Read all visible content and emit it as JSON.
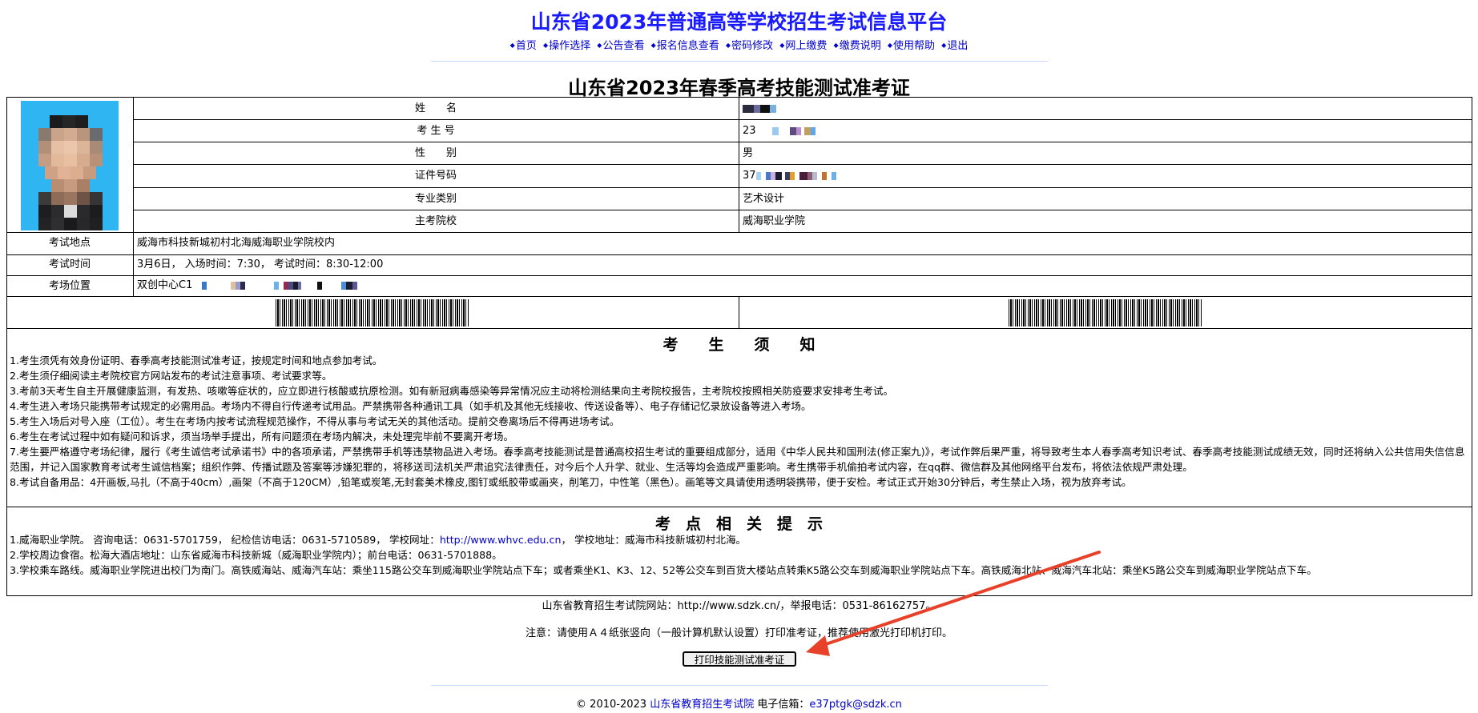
{
  "site": {
    "title": "山东省2023年普通高等学校招生考试信息平台",
    "nav": [
      "首页",
      "操作选择",
      "公告查看",
      "报名信息查看",
      "密码修改",
      "网上缴费",
      "缴费说明",
      "使用帮助",
      "退出"
    ]
  },
  "ticket": {
    "title": "山东省2023年春季高考技能测试准考证",
    "rows": [
      {
        "label": "姓　　名",
        "value": ""
      },
      {
        "label": "考 生 号",
        "value": "23"
      },
      {
        "label": "性　　别",
        "value": "男"
      },
      {
        "label": "证件号码",
        "value": "37"
      },
      {
        "label": "专业类别",
        "value": "艺术设计"
      },
      {
        "label": "主考院校",
        "value": "威海职业学院"
      }
    ],
    "exam_location_label": "考试地点",
    "exam_location": "威海市科技新城初村北海威海职业学院校内",
    "exam_time_label": "考试时间",
    "exam_time": "3月6日， 入场时间：7:30， 考试时间：8:30-12:00",
    "room_label": "考场位置",
    "room": "双创中心C1"
  },
  "notice": {
    "title": "考　　生　　须　　知",
    "items": [
      "1.考生须凭有效身份证明、春季高考技能测试准考证，按规定时间和地点参加考试。",
      "2.考生须仔细阅读主考院校官方网站发布的考试注意事项、考试要求等。",
      "3.考前3天考生自主开展健康监测，有发热、咳嗽等症状的，应立即进行核酸或抗原检测。如有新冠病毒感染等异常情况应主动将检测结果向主考院校报告，主考院校按照相关防疫要求安排考生考试。",
      "4.考生进入考场只能携带考试规定的必需用品。考场内不得自行传递考试用品。严禁携带各种通讯工具（如手机及其他无线接收、传送设备等）、电子存储记忆录放设备等进入考场。",
      "5.考生入场后对号入座（工位）。考生在考场内按考试流程规范操作，不得从事与考试无关的其他活动。提前交卷离场后不得再进场考试。",
      "6.考生在考试过程中如有疑问和诉求，须当场举手提出，所有问题须在考场内解决，未处理完毕前不要离开考场。",
      "7.考生要严格遵守考场纪律，履行《考生诚信考试承诺书》中的各项承诺，严禁携带手机等违禁物品进入考场。春季高考技能测试是普通高校招生考试的重要组成部分，适用《中华人民共和国刑法(修正案九)》，考试作弊后果严重，将导致考生本人春季高考知识考试、春季高考技能测试成绩无效，同时还将纳入公共信用失信信息范围，并记入国家教育考试考生诚信档案；组织作弊、传播试题及答案等涉嫌犯罪的，将移送司法机关严肃追究法律责任，对今后个人升学、就业、生活等均会造成严重影响。考生携带手机偷拍考试内容，在qq群、微信群及其他网络平台发布，将依法依规严肃处理。",
      "8.考试自备用品：4开画板,马扎（不高于40cm）,画架（不高于120CM）,铅笔或炭笔,无封套美术橡皮,图钉或纸胶带或画夹，削笔刀，中性笔（黑色）。画笔等文具请使用透明袋携带，便于安检。考试正式开始30分钟后，考生禁止入场，视为放弃考试。"
    ]
  },
  "tips": {
    "title": "考　点　相　关　提　示",
    "line1_prefix": "1.威海职业学院。 咨询电话：0631-5701759， 纪检信访电话：0631-5710589， 学校网址：",
    "line1_link": "http://www.whvc.edu.cn",
    "line1_suffix": "， 学校地址：威海市科技新城初村北海。",
    "line2": "2.学校周边食宿。松海大酒店地址：山东省威海市科技新城（威海职业学院内）；前台电话：0631-5701888。",
    "line3": "3.学校乘车路线。威海职业学院进出校门为南门。高铁威海站、威海汽车站：乘坐115路公交车到威海职业学院站点下车；或者乘坐K1、K3、12、52等公交车到百货大楼站点转乘K5路公交车到威海职业学院站点下车。高铁威海北站、威海汽车北站：乘坐K5路公交车到威海职业学院站点下车。"
  },
  "footer": {
    "website_line": "山东省教育招生考试院网站：http://www.sdzk.cn/，举报电话：0531-86162757。",
    "note": "注意：请使用Ａ４纸张竖向（一般计算机默认设置）打印准考证，推荐使用激光打印机打印。",
    "print_button": "打印技能测试准考证",
    "copyright_prefix": "© 2010-2023",
    "copyright_org": "山东省教育招生考试院",
    "copyright_email_label": "电子信箱：",
    "copyright_email": "e37ptgk@sdzk.cn"
  },
  "colors": {
    "title_blue": "#1a1aff",
    "link_blue": "#0000cc",
    "photo_bg": "#2fb5f2",
    "annotation_arrow": "#e8412a"
  },
  "icons": [
    "nav-diamond-icon",
    "annotation-arrow-icon"
  ]
}
